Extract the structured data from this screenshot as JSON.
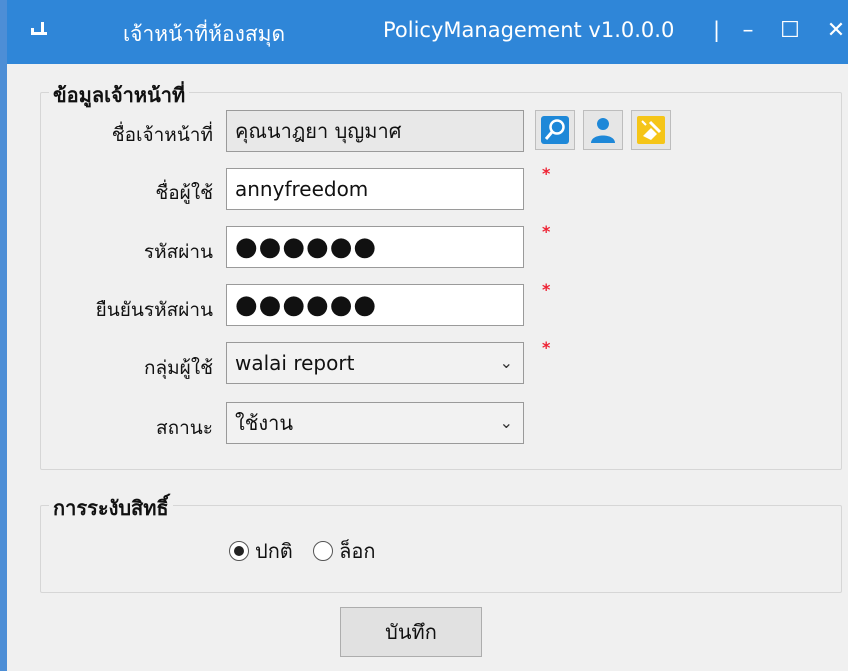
{
  "titlebar": {
    "left_title": "เจ้าหน้าที่ห้องสมุด",
    "app_title": "PolicyManagement v1.0.0.0",
    "separator": "|",
    "minimize": "–",
    "maximize": "☐",
    "close": "✕"
  },
  "officer_group": {
    "legend": "ข้อมูลเจ้าหน้าที่",
    "name_label": "ชื่อเจ้าหน้าที่",
    "name_value": "คุณนาฎยา บุญมาศ",
    "username_label": "ชื่อผู้ใช้",
    "username_value": "annyfreedom",
    "password_label": "รหัสผ่าน",
    "password_value": "●●●●●●",
    "confirm_label": "ยืนยันรหัสผ่าน",
    "confirm_value": "●●●●●●",
    "group_label": "กลุ่มผู้ใช้",
    "group_value": "walai report",
    "status_label": "สถานะ",
    "status_value": "ใช้งาน",
    "required_mark": "*",
    "chevron": "⌄"
  },
  "suspend_group": {
    "legend": "การระงับสิทธิ์",
    "option_normal": "ปกติ",
    "option_lock": "ล็อก",
    "selected": "ปกติ"
  },
  "save_label": "บันทึก",
  "icons": {
    "search": "search-icon",
    "user": "user-icon",
    "clear": "clear-icon"
  },
  "colors": {
    "titlebar": "#2f86d8",
    "required": "#ee2233"
  }
}
